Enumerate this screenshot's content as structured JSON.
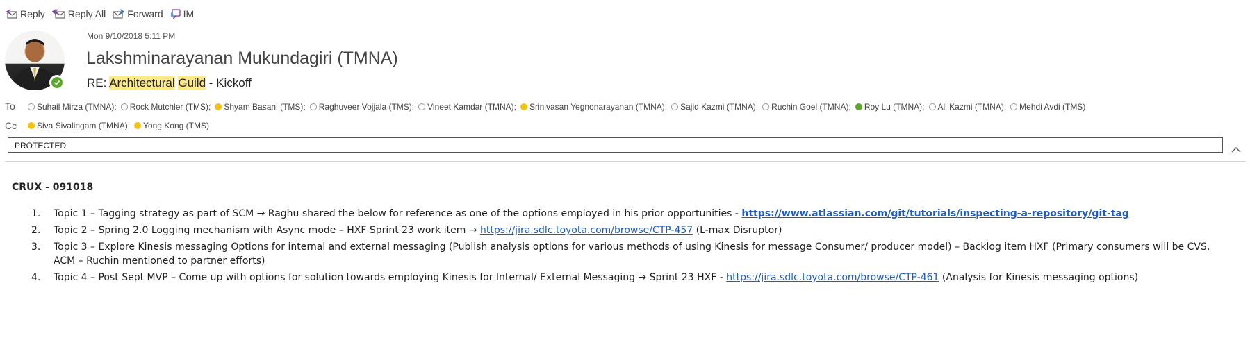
{
  "toolbar": {
    "reply": "Reply",
    "reply_all": "Reply All",
    "forward": "Forward",
    "im": "IM"
  },
  "message": {
    "date": "Mon 9/10/2018 5:11 PM",
    "sender": "Lakshminarayanan Mukundagiri (TMNA)",
    "subject_prefix": "RE: ",
    "subject_hl1": "Architectural",
    "subject_space": " ",
    "subject_hl2": "Guild",
    "subject_suffix": " - Kickoff",
    "to_label": "To",
    "cc_label": "Cc",
    "to": [
      {
        "name": "Suhail Mirza (TMNA);",
        "status": "offline"
      },
      {
        "name": "Rock Mutchler (TMS);",
        "status": "offline"
      },
      {
        "name": "Shyam Basani (TMS);",
        "status": "away"
      },
      {
        "name": "Raghuveer Vojjala (TMS);",
        "status": "offline"
      },
      {
        "name": "Vineet Kamdar (TMNA);",
        "status": "offline"
      },
      {
        "name": "Srinivasan Yegnonarayanan (TMNA);",
        "status": "away"
      },
      {
        "name": "Sajid Kazmi (TMNA);",
        "status": "offline"
      },
      {
        "name": "Ruchin Goel (TMNA);",
        "status": "offline"
      },
      {
        "name": "Roy Lu (TMNA);",
        "status": "available"
      },
      {
        "name": "Ali Kazmi (TMNA);",
        "status": "offline"
      },
      {
        "name": "Mehdi Avdi (TMS)",
        "status": "offline"
      }
    ],
    "cc": [
      {
        "name": "Siva Sivalingam (TMNA);",
        "status": "away"
      },
      {
        "name": "Yong Kong (TMS)",
        "status": "away"
      }
    ],
    "classification": "PROTECTED"
  },
  "body": {
    "title": "CRUX - 091018",
    "items": [
      {
        "num": "1.",
        "text": "Topic 1 – Tagging strategy as part of SCM → Raghu shared the below for reference as one of the options employed in his prior opportunities - ",
        "link": "https://www.atlassian.com/git/tutorials/inspecting-a-repository/git-tag",
        "after": ""
      },
      {
        "num": "2.",
        "text": "Topic 2 – Spring 2.0 Logging mechanism with Async mode – HXF Sprint 23 work item → ",
        "link": "https://jira.sdlc.toyota.com/browse/CTP-457",
        "after": " (L-max Disruptor)"
      },
      {
        "num": "3.",
        "text": "Topic 3 – Explore Kinesis messaging Options for internal and external messaging (Publish analysis options for various methods of using Kinesis for message Consumer/ producer model) – Backlog item HXF (Primary consumers will be CVS, ACM – Ruchin mentioned to partner efforts)",
        "link": "",
        "after": ""
      },
      {
        "num": "4.",
        "text": "Topic 4 – Post Sept MVP – Come up with options for solution towards employing Kinesis for Internal/ External Messaging → Sprint 23 HXF - ",
        "link": "https://jira.sdlc.toyota.com/browse/CTP-461",
        "after": " (Analysis for Kinesis messaging options)"
      }
    ]
  }
}
